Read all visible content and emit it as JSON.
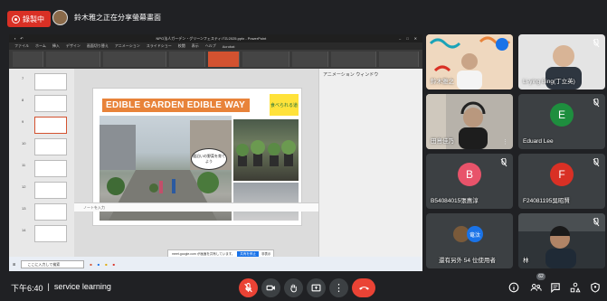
{
  "recording": {
    "label": "錄製中"
  },
  "presenter": {
    "text": "鈴木雅之正在分享螢幕畫面"
  },
  "shared_screen": {
    "ppt_title": "NPO法人ガーデン・グリーンフェスティバル2025.pptx - PowerPoint",
    "ppt_tabs": [
      "ファイル",
      "ホーム",
      "挿入",
      "デザイン",
      "画面切り替え",
      "アニメーション",
      "スライドショー",
      "校閲",
      "表示",
      "ヘルプ",
      "Acrobat"
    ],
    "thumbnail_numbers": [
      "7",
      "8",
      "9",
      "10",
      "11",
      "12",
      "13",
      "14"
    ],
    "slide_title": "EDIBLE GARDEN EDIBLE WAY",
    "slide_tag": "食べられる道",
    "slide_bubble": "道沿いの野菜を育てよう",
    "animation_pane_title": "アニメーション ウィンドウ",
    "notes_placeholder": "ノートを入力",
    "notify_text": "meet.google.com が画面を共有しています。",
    "notify_stop": "共有を停止",
    "notify_hide": "非表示",
    "win_search": "ここに入力して検索"
  },
  "participants": [
    {
      "name": "鈴木雅之",
      "type": "video",
      "muted": true
    },
    {
      "name": "Li-ying Bing(丁立英)",
      "type": "video",
      "muted": true
    },
    {
      "name": "田島佳乃",
      "type": "video",
      "muted": false
    },
    {
      "name": "Eduard Lee",
      "type": "avatar",
      "letter": "E",
      "color": "#1e8e3e",
      "muted": true
    },
    {
      "name": "B54084015張惠淳",
      "type": "avatar",
      "letter": "B",
      "color": "#e8536a",
      "muted": true
    },
    {
      "name": "F24081195吳昭賢",
      "type": "avatar",
      "letter": "F",
      "color": "#d93025",
      "muted": true
    },
    {
      "name": "還有另外 54 位使用者",
      "type": "others",
      "avatars": [
        "竜汰"
      ]
    },
    {
      "name": "林",
      "type": "video",
      "muted": true
    }
  ],
  "bottom": {
    "time": "下午6:40",
    "separator": "|",
    "meeting_name": "service learning",
    "participant_count": "62"
  }
}
